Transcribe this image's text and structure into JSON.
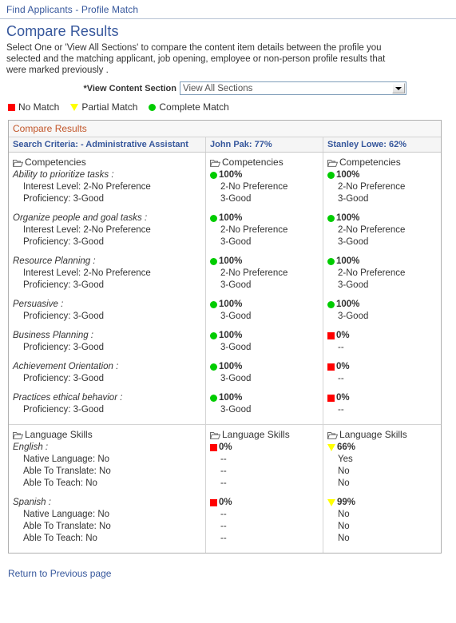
{
  "breadcrumb": {
    "label": "Find Applicants - Profile Match"
  },
  "page": {
    "title": "Compare Results",
    "intro": "Select One or 'View All Sections' to compare the content item details between  the profile you selected and the matching applicant, job opening, employee or non-person profile results that were marked previously ."
  },
  "field": {
    "label": "*View Content Section",
    "selected": "View All Sections",
    "options": [
      "View All Sections"
    ],
    "icon": "chevron-down-icon"
  },
  "legend": [
    {
      "icon": "red-square-icon",
      "color": "#ff0000",
      "label": "No Match"
    },
    {
      "icon": "yellow-triangle-icon",
      "color": "#ffff00",
      "label": "Partial Match"
    },
    {
      "icon": "green-circle-icon",
      "color": "#00cc00",
      "label": "Complete Match"
    }
  ],
  "panel": {
    "title": "Compare Results",
    "title_color": "#c2562a",
    "columns": [
      {
        "label": "Search Criteria: - Administrative Assistant"
      },
      {
        "label": "John Pak: 77%"
      },
      {
        "label": "Stanley Lowe: 62%"
      }
    ]
  },
  "sections": [
    {
      "name": "Competencies",
      "icon": "folder-icon",
      "criteria_items": [
        {
          "name": "Ability to prioritize tasks :",
          "details": [
            "Interest Level: 2-No Preference",
            "Proficiency: 3-Good"
          ]
        },
        {
          "name": "Organize people and goal tasks :",
          "details": [
            "Interest Level: 2-No Preference",
            "Proficiency: 3-Good"
          ]
        },
        {
          "name": "Resource Planning :",
          "details": [
            "Interest Level: 2-No Preference",
            "Proficiency: 3-Good"
          ]
        },
        {
          "name": "Persuasive :",
          "details": [
            "Proficiency: 3-Good"
          ]
        },
        {
          "name": "Business Planning :",
          "details": [
            "Proficiency: 3-Good"
          ]
        },
        {
          "name": "Achievement Orientation :",
          "details": [
            "Proficiency: 3-Good"
          ]
        },
        {
          "name": "Practices ethical behavior :",
          "details": [
            "Proficiency: 3-Good"
          ]
        }
      ],
      "candidates": [
        {
          "name": "John Pak",
          "items": [
            {
              "indicator": "green-circle-icon",
              "percent": "100%",
              "values": [
                "2-No Preference",
                "3-Good"
              ]
            },
            {
              "indicator": "green-circle-icon",
              "percent": "100%",
              "values": [
                "2-No Preference",
                "3-Good"
              ]
            },
            {
              "indicator": "green-circle-icon",
              "percent": "100%",
              "values": [
                "2-No Preference",
                "3-Good"
              ]
            },
            {
              "indicator": "green-circle-icon",
              "percent": "100%",
              "values": [
                "3-Good"
              ]
            },
            {
              "indicator": "green-circle-icon",
              "percent": "100%",
              "values": [
                "3-Good"
              ]
            },
            {
              "indicator": "green-circle-icon",
              "percent": "100%",
              "values": [
                "3-Good"
              ]
            },
            {
              "indicator": "green-circle-icon",
              "percent": "100%",
              "values": [
                "3-Good"
              ]
            }
          ]
        },
        {
          "name": "Stanley Lowe",
          "items": [
            {
              "indicator": "green-circle-icon",
              "percent": "100%",
              "values": [
                "2-No Preference",
                "3-Good"
              ]
            },
            {
              "indicator": "green-circle-icon",
              "percent": "100%",
              "values": [
                "2-No Preference",
                "3-Good"
              ]
            },
            {
              "indicator": "green-circle-icon",
              "percent": "100%",
              "values": [
                "2-No Preference",
                "3-Good"
              ]
            },
            {
              "indicator": "green-circle-icon",
              "percent": "100%",
              "values": [
                "3-Good"
              ]
            },
            {
              "indicator": "red-square-icon",
              "percent": "0%",
              "values": [
                "--"
              ]
            },
            {
              "indicator": "red-square-icon",
              "percent": "0%",
              "values": [
                "--"
              ]
            },
            {
              "indicator": "red-square-icon",
              "percent": "0%",
              "values": [
                "--"
              ]
            }
          ]
        }
      ]
    },
    {
      "name": "Language Skills",
      "icon": "folder-icon",
      "criteria_items": [
        {
          "name": "English :",
          "details": [
            "Native Language: No",
            "Able To Translate: No",
            "Able To Teach: No"
          ]
        },
        {
          "name": "Spanish :",
          "details": [
            "Native Language: No",
            "Able To Translate: No",
            "Able To Teach: No"
          ]
        }
      ],
      "candidates": [
        {
          "name": "John Pak",
          "items": [
            {
              "indicator": "red-square-icon",
              "percent": "0%",
              "values": [
                "--",
                "--",
                "--"
              ]
            },
            {
              "indicator": "red-square-icon",
              "percent": "0%",
              "values": [
                "--",
                "--",
                "--"
              ]
            }
          ]
        },
        {
          "name": "Stanley Lowe",
          "items": [
            {
              "indicator": "yellow-triangle-icon",
              "percent": "66%",
              "values": [
                "Yes",
                "No",
                "No"
              ]
            },
            {
              "indicator": "yellow-triangle-icon",
              "percent": "99%",
              "values": [
                "No",
                "No",
                "No"
              ]
            }
          ]
        }
      ]
    }
  ],
  "footer": {
    "return_link": "Return to Previous page"
  }
}
